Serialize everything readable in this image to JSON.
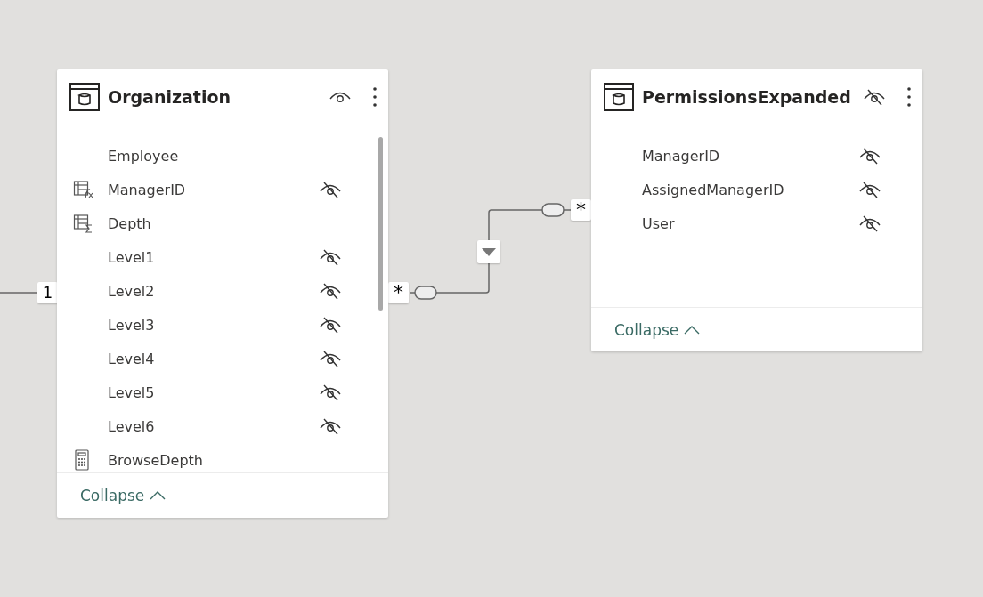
{
  "tables": [
    {
      "title": "Organization",
      "hidden": false,
      "fields": [
        {
          "name": "Employee",
          "kind": "column",
          "hidden": false
        },
        {
          "name": "ManagerID",
          "kind": "fx",
          "hidden": true
        },
        {
          "name": "Depth",
          "kind": "sigma",
          "hidden": false
        },
        {
          "name": "Level1",
          "kind": "column",
          "hidden": true
        },
        {
          "name": "Level2",
          "kind": "column",
          "hidden": true
        },
        {
          "name": "Level3",
          "kind": "column",
          "hidden": true
        },
        {
          "name": "Level4",
          "kind": "column",
          "hidden": true
        },
        {
          "name": "Level5",
          "kind": "column",
          "hidden": true
        },
        {
          "name": "Level6",
          "kind": "column",
          "hidden": true
        },
        {
          "name": "BrowseDepth",
          "kind": "measure",
          "hidden": false
        }
      ],
      "footer": "Collapse"
    },
    {
      "title": "PermissionsExpanded",
      "hidden": true,
      "fields": [
        {
          "name": "ManagerID",
          "kind": "column",
          "hidden": true
        },
        {
          "name": "AssignedManagerID",
          "kind": "column",
          "hidden": true
        },
        {
          "name": "User",
          "kind": "column",
          "hidden": true
        }
      ],
      "footer": "Collapse"
    }
  ],
  "relationships": [
    {
      "from_end": "1"
    },
    {
      "from_end": "*",
      "to_end": "*"
    }
  ]
}
